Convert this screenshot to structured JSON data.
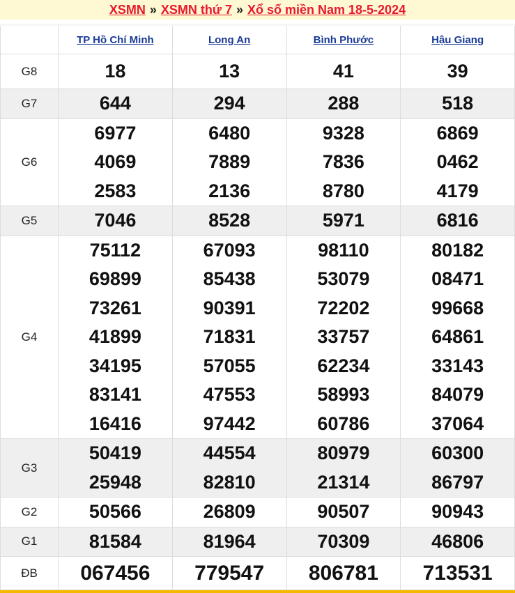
{
  "breadcrumb": {
    "home": "XSMN",
    "sep": "»",
    "day": "XSMN thứ 7",
    "current": "Xổ số miền Nam 18-5-2024"
  },
  "provinces": [
    "TP Hồ Chí Minh",
    "Long An",
    "Bình Phước",
    "Hậu Giang"
  ],
  "prizes": [
    {
      "label": "G8",
      "values": [
        [
          "18"
        ],
        [
          "13"
        ],
        [
          "41"
        ],
        [
          "39"
        ]
      ]
    },
    {
      "label": "G7",
      "values": [
        [
          "644"
        ],
        [
          "294"
        ],
        [
          "288"
        ],
        [
          "518"
        ]
      ]
    },
    {
      "label": "G6",
      "values": [
        [
          "6977",
          "4069",
          "2583"
        ],
        [
          "6480",
          "7889",
          "2136"
        ],
        [
          "9328",
          "7836",
          "8780"
        ],
        [
          "6869",
          "0462",
          "4179"
        ]
      ]
    },
    {
      "label": "G5",
      "values": [
        [
          "7046"
        ],
        [
          "8528"
        ],
        [
          "5971"
        ],
        [
          "6816"
        ]
      ]
    },
    {
      "label": "G4",
      "values": [
        [
          "75112",
          "69899",
          "73261",
          "41899",
          "34195",
          "83141",
          "16416"
        ],
        [
          "67093",
          "85438",
          "90391",
          "71831",
          "57055",
          "47553",
          "97442"
        ],
        [
          "98110",
          "53079",
          "72202",
          "33757",
          "62234",
          "58993",
          "60786"
        ],
        [
          "80182",
          "08471",
          "99668",
          "64861",
          "33143",
          "84079",
          "37064"
        ]
      ]
    },
    {
      "label": "G3",
      "values": [
        [
          "50419",
          "25948"
        ],
        [
          "44554",
          "82810"
        ],
        [
          "80979",
          "21314"
        ],
        [
          "60300",
          "86797"
        ]
      ]
    },
    {
      "label": "G2",
      "values": [
        [
          "50566"
        ],
        [
          "26809"
        ],
        [
          "90507"
        ],
        [
          "90943"
        ]
      ]
    },
    {
      "label": "G1",
      "values": [
        [
          "81584"
        ],
        [
          "81964"
        ],
        [
          "70309"
        ],
        [
          "46806"
        ]
      ]
    },
    {
      "label": "ĐB",
      "values": [
        [
          "067456"
        ],
        [
          "779547"
        ],
        [
          "806781"
        ],
        [
          "713531"
        ]
      ]
    }
  ],
  "colors": {
    "accent": "#e8192c",
    "header_link": "#1a3b95",
    "alt_row": "#efefef",
    "bottom_bar": "#f5b800"
  }
}
